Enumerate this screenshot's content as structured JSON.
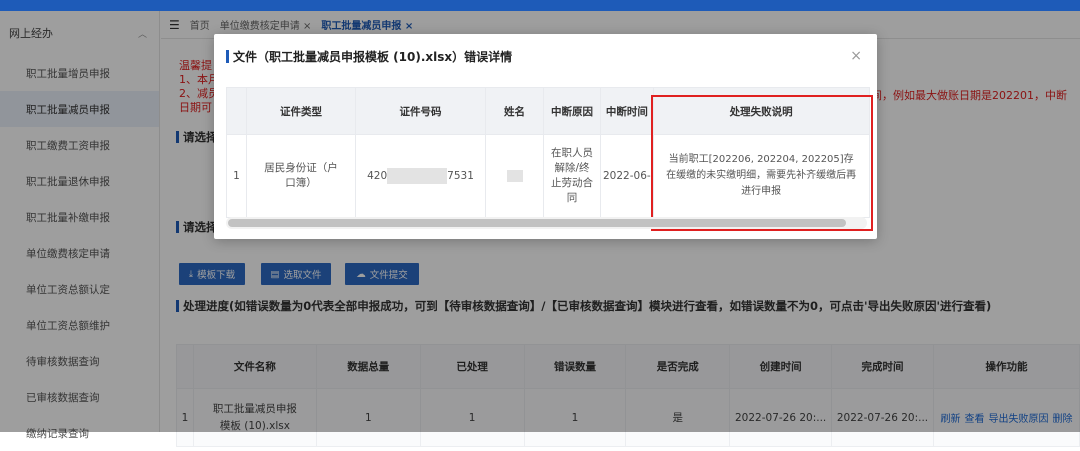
{
  "sidebar": {
    "header": "网上经办",
    "items": [
      {
        "label": "职工批量增员申报"
      },
      {
        "label": "职工批量减员申报"
      },
      {
        "label": "职工缴费工资申报"
      },
      {
        "label": "职工批量退休申报"
      },
      {
        "label": "职工批量补缴申报"
      },
      {
        "label": "单位缴费核定申请"
      },
      {
        "label": "单位工资总额认定"
      },
      {
        "label": "单位工资总额维护"
      },
      {
        "label": "待审核数据查询"
      },
      {
        "label": "已审核数据查询"
      },
      {
        "label": "缴纳记录查询"
      }
    ]
  },
  "tabs": {
    "menu_icon": "menu-icon",
    "home": "首页",
    "tab1": "单位缴费核定申请",
    "tab1_close": "×",
    "tab2": "职工批量减员申报",
    "tab2_close": "×"
  },
  "warning": {
    "l1": "温馨提",
    "l2": "1、本月",
    "l3": "2、减员",
    "l4": "日期可",
    "right_line": "间，例如最大做账日期是202201，中断"
  },
  "sections": {
    "select1": "请选择",
    "select2": "请选择"
  },
  "buttons": {
    "template_download": "模板下载",
    "select_file": "选取文件",
    "submit_file": "文件提交"
  },
  "progress": {
    "title": "处理进度(如错误数量为0代表全部申报成功，可到【待审核数据查询】/【已审核数据查询】模块进行查看，如错误数量不为0，可点击'导出失败原因'进行查看)",
    "headers": [
      "文件名称",
      "数据总量",
      "已处理",
      "错误数量",
      "是否完成",
      "创建时间",
      "完成时间",
      "操作功能"
    ],
    "row": {
      "index": "1",
      "file_name": "职工批量减员申报模板 (10).xlsx",
      "total": "1",
      "processed": "1",
      "errors": "1",
      "done": "是",
      "created": "2022-07-26 20:...",
      "finished": "2022-07-26 20:...",
      "op_refresh": "刷新",
      "op_view": "查看",
      "op_export": "导出失败原因",
      "op_delete": "删除"
    }
  },
  "modal": {
    "title": "文件（职工批量减员申报模板 (10).xlsx）错误详情",
    "close": "×",
    "headers": [
      "证件类型",
      "证件号码",
      "姓名",
      "中断原因",
      "中断时间",
      "处理失败说明"
    ],
    "row": {
      "index": "1",
      "id_type": "居民身份证（户口簿）",
      "id_prefix": "420",
      "id_suffix": "7531",
      "reason": "在职人员解除/终止劳动合同",
      "time": "2022-06-",
      "fail_msg": "当前职工[202206, 202204, 202205]存在缓缴的未实缴明细，需要先补齐缓缴后再进行申报"
    }
  }
}
